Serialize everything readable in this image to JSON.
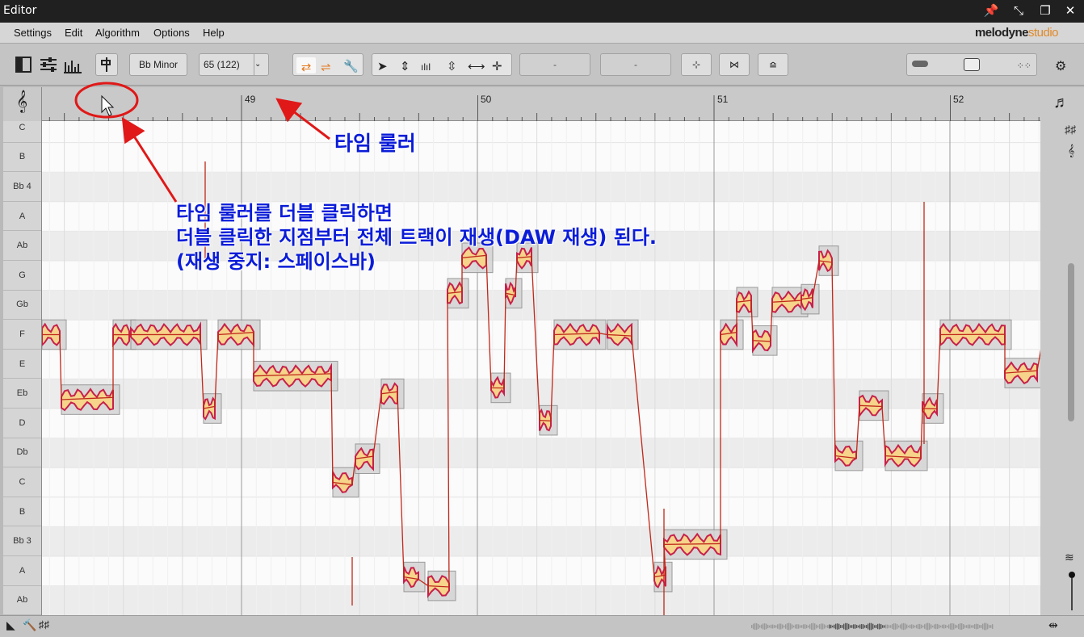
{
  "window": {
    "title": "Editor",
    "buttons": [
      "pin-icon",
      "restore-icon",
      "maximize-icon",
      "close-icon"
    ]
  },
  "menu": [
    "Settings",
    "Edit",
    "Algorithm",
    "Options",
    "Help"
  ],
  "brand": {
    "main": "melodyne",
    "sub": "studio",
    "accent": "#e08a2a"
  },
  "toolbar": {
    "scale": "Bb Minor",
    "tempo": "65 (122)",
    "field_a": "-",
    "field_b": "-"
  },
  "time_ruler": {
    "bars": [
      "49",
      "50",
      "51",
      "52"
    ]
  },
  "pitch_ruler": {
    "rows": [
      "C",
      "B",
      "Bb 4",
      "A",
      "Ab",
      "G",
      "Gb",
      "F",
      "E",
      "Eb",
      "D",
      "Db",
      "C",
      "B",
      "Bb 3",
      "A",
      "Ab"
    ]
  },
  "annotations": {
    "ruler_label": "타임 룰러",
    "line1": "타임 룰러를 더블 클릭하면",
    "line2": "더블 클릭한 지점부터 전체 트랙이 재생(DAW 재생) 된다.",
    "line3": "(재생 중지: 스페이스바)"
  },
  "colors": {
    "annotation_text": "#0a1cd8",
    "annotation_arrow": "#e01818",
    "blob_fill": "#f6d48a",
    "blob_edge": "#c8204a",
    "pitch_line": "#c0281a"
  }
}
